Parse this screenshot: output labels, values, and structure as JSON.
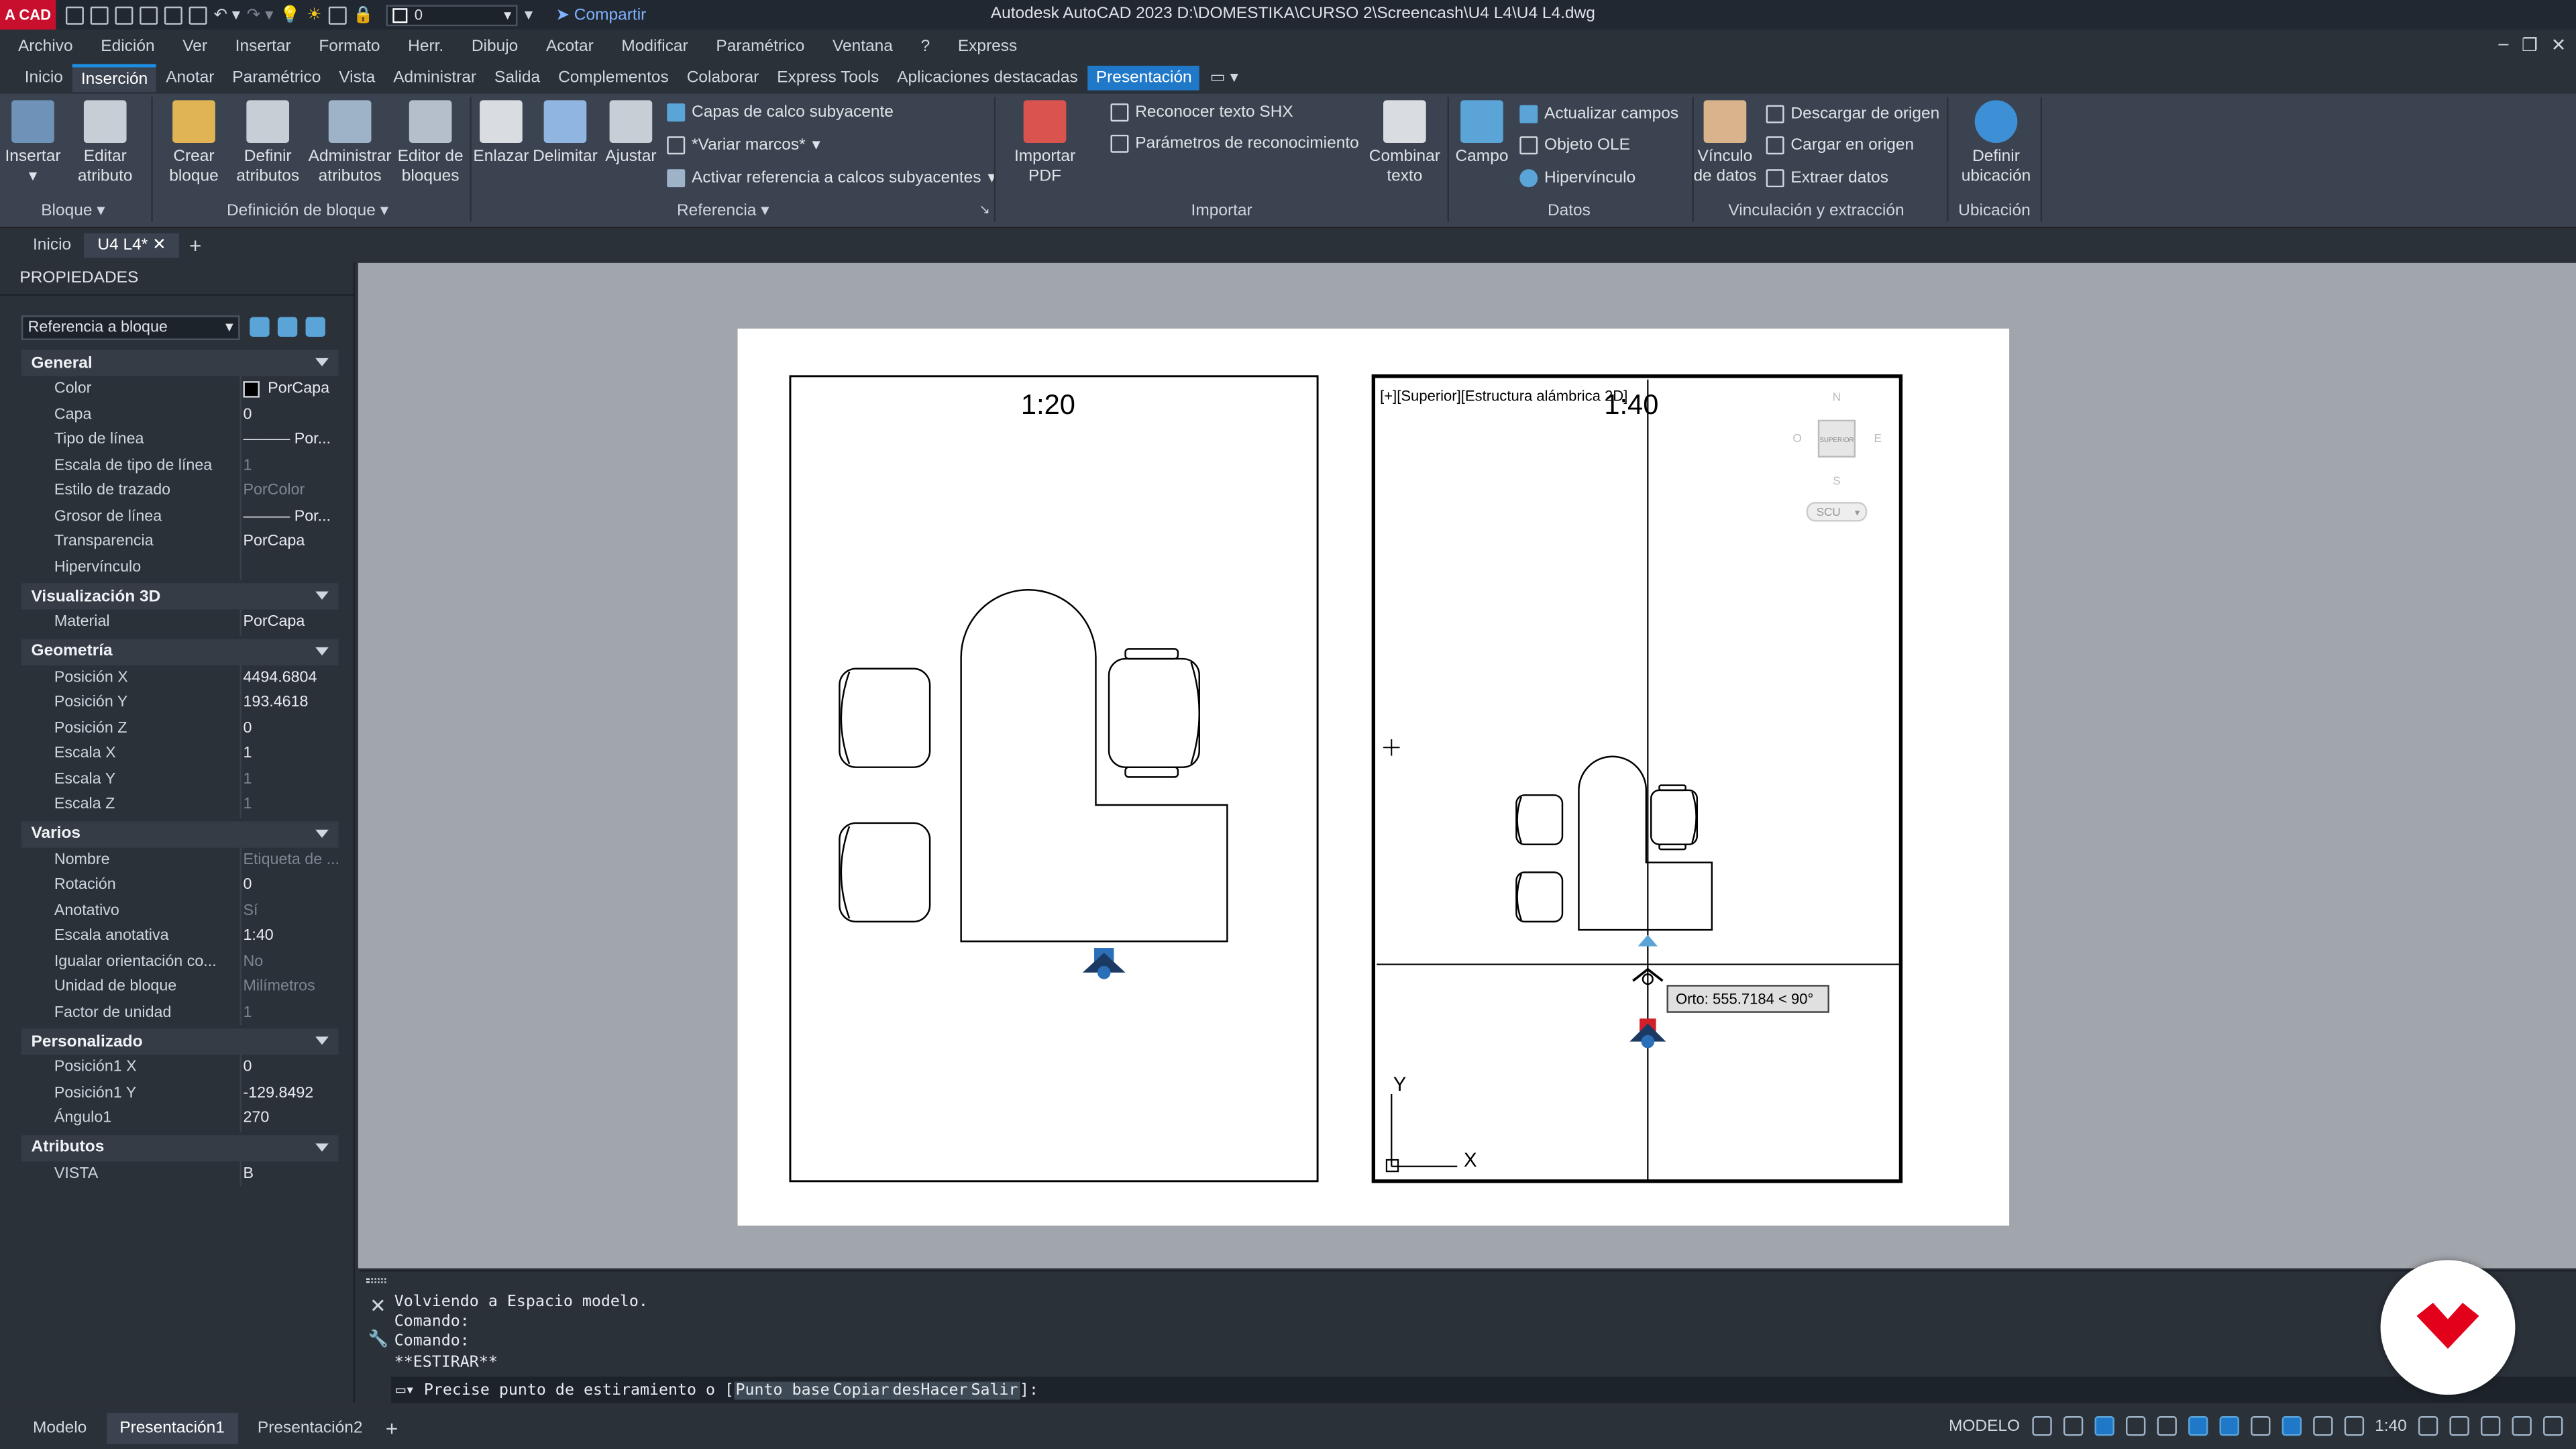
{
  "titlebar": {
    "logo": "A CAD",
    "layer": "0",
    "share": "Compartir",
    "title": "Autodesk AutoCAD 2023    D:\\DOMESTIKA\\CURSO 2\\Screencash\\U4 L4\\U4 L4.dwg"
  },
  "menu": [
    "Archivo",
    "Edición",
    "Ver",
    "Insertar",
    "Formato",
    "Herr.",
    "Dibujo",
    "Acotar",
    "Modificar",
    "Paramétrico",
    "Ventana",
    "?",
    "Express"
  ],
  "ribbon_tabs": [
    "Inicio",
    "Inserción",
    "Anotar",
    "Paramétrico",
    "Vista",
    "Administrar",
    "Salida",
    "Complementos",
    "Colaborar",
    "Express Tools",
    "Aplicaciones destacadas",
    "Presentación"
  ],
  "ribbon": {
    "insertar": "Insertar",
    "editar_atributo": [
      "Editar",
      "atributo"
    ],
    "crear_bloque": [
      "Crear",
      "bloque"
    ],
    "definir_atributos": [
      "Definir",
      "atributos"
    ],
    "administrar_atributos": [
      "Administrar",
      "atributos"
    ],
    "editor_bloques": [
      "Editor de",
      "bloques"
    ],
    "enlazar": "Enlazar",
    "delimitar": "Delimitar",
    "ajustar": "Ajustar",
    "capas_calco": "Capas de calco subyacente",
    "variar_marcos": "*Variar marcos*",
    "activar_ref": "Activar referencia a calcos subyacentes",
    "importar_pdf": [
      "Importar",
      "PDF"
    ],
    "reconocer_shx": "Reconocer texto SHX",
    "parametros_reconocimiento": "Parámetros de reconocimiento",
    "combinar_texto": [
      "Combinar",
      "texto"
    ],
    "campo": "Campo",
    "actualizar_campos": "Actualizar campos",
    "objeto_ole": "Objeto OLE",
    "hipervinculo": "Hipervínculo",
    "vinculo_datos": [
      "Vínculo",
      "de datos"
    ],
    "descargar_origen": "Descargar de origen",
    "cargar_origen": "Cargar en origen",
    "extraer_datos": "Extraer  datos",
    "definir_ubicacion": [
      "Definir",
      "ubicación"
    ],
    "panels": [
      "Bloque",
      "Definición de bloque",
      "Referencia",
      "Importar",
      "Datos",
      "Vinculación y extracción",
      "Ubicación"
    ]
  },
  "doc_tabs": [
    "Inicio",
    "U4 L4*"
  ],
  "properties": {
    "title": "PROPIEDADES",
    "selector": "Referencia a bloque",
    "sections": [
      {
        "name": "General",
        "rows": [
          {
            "k": "Color",
            "v": "PorCapa",
            "swatch": true
          },
          {
            "k": "Capa",
            "v": "0"
          },
          {
            "k": "Tipo de línea",
            "v": "——— Por..."
          },
          {
            "k": "Escala de tipo de línea",
            "v": "1",
            "dim": true
          },
          {
            "k": "Estilo de trazado",
            "v": "PorColor",
            "dim": true
          },
          {
            "k": "Grosor de línea",
            "v": "——— Por..."
          },
          {
            "k": "Transparencia",
            "v": "PorCapa"
          },
          {
            "k": "Hipervínculo",
            "v": ""
          }
        ]
      },
      {
        "name": "Visualización 3D",
        "rows": [
          {
            "k": "Material",
            "v": "PorCapa"
          }
        ]
      },
      {
        "name": "Geometría",
        "rows": [
          {
            "k": "Posición X",
            "v": "4494.6804"
          },
          {
            "k": "Posición Y",
            "v": "193.4618"
          },
          {
            "k": "Posición Z",
            "v": "0"
          },
          {
            "k": "Escala X",
            "v": "1"
          },
          {
            "k": "Escala Y",
            "v": "1",
            "dim": true
          },
          {
            "k": "Escala Z",
            "v": "1",
            "dim": true
          }
        ]
      },
      {
        "name": "Varios",
        "rows": [
          {
            "k": "Nombre",
            "v": "Etiqueta de ...",
            "dim": true
          },
          {
            "k": "Rotación",
            "v": "0"
          },
          {
            "k": "Anotativo",
            "v": "Sí",
            "dim": true
          },
          {
            "k": "Escala anotativa",
            "v": "1:40"
          },
          {
            "k": "Igualar orientación co...",
            "v": "No",
            "dim": true
          },
          {
            "k": "Unidad de bloque",
            "v": "Milímetros",
            "dim": true
          },
          {
            "k": "Factor de unidad",
            "v": "1",
            "dim": true
          }
        ]
      },
      {
        "name": "Personalizado",
        "rows": [
          {
            "k": "Posición1 X",
            "v": "0"
          },
          {
            "k": "Posición1 Y",
            "v": "-129.8492"
          },
          {
            "k": "Ángulo1",
            "v": "270"
          }
        ]
      },
      {
        "name": "Atributos",
        "rows": [
          {
            "k": "VISTA",
            "v": "B"
          }
        ]
      }
    ]
  },
  "drawing": {
    "scale_left": "1:20",
    "scale_right": "1:40",
    "viewport_label": "[+][Superior][Estructura alámbrica 2D]",
    "viewcube_top": "SUPERIOR",
    "viewcube_n": "N",
    "viewcube_s": "S",
    "viewcube_e": "E",
    "viewcube_w": "O",
    "ucs_menu": "SCU",
    "tooltip": "Orto: 555.7184 < 90°",
    "axis_y": "Y",
    "axis_x": "X"
  },
  "command": {
    "history": [
      "Volviendo a Espacio modelo.",
      "Comando:",
      "Comando:",
      "**ESTIRAR**"
    ],
    "prompt": "Precise punto de estiramiento o [",
    "options": [
      "Punto base",
      "Copiar",
      "desHacer",
      "Salir"
    ],
    "prompt_end": "]:"
  },
  "status": {
    "tabs": [
      "Modelo",
      "Presentación1",
      "Presentación2"
    ],
    "mode": "MODELO",
    "scale": "1:40"
  },
  "colors": {
    "accent": "#1f79c8",
    "brand": "#e3001b"
  }
}
